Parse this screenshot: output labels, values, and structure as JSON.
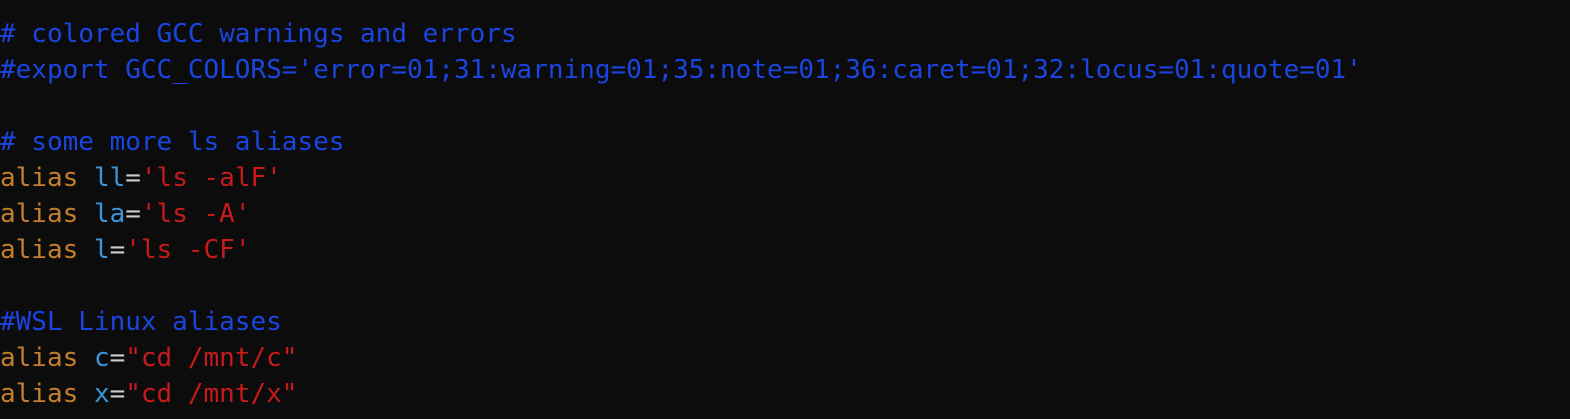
{
  "lines": [
    {
      "type": "comment",
      "text": "# colored GCC warnings and errors"
    },
    {
      "type": "comment",
      "text": "#export GCC_COLORS='error=01;31:warning=01;35:note=01;36:caret=01;32:locus=01:quote=01'"
    },
    {
      "type": "blank"
    },
    {
      "type": "comment",
      "text": "# some more ls aliases"
    },
    {
      "type": "alias",
      "keyword": "alias",
      "name": "ll",
      "eq": "=",
      "value": "'ls -alF'"
    },
    {
      "type": "alias",
      "keyword": "alias",
      "name": "la",
      "eq": "=",
      "value": "'ls -A'"
    },
    {
      "type": "alias",
      "keyword": "alias",
      "name": "l",
      "eq": "=",
      "value": "'ls -CF'"
    },
    {
      "type": "blank"
    },
    {
      "type": "comment",
      "text": "#WSL Linux aliases"
    },
    {
      "type": "alias",
      "keyword": "alias",
      "name": "c",
      "eq": "=",
      "value": "\"cd /mnt/c\""
    },
    {
      "type": "alias",
      "keyword": "alias",
      "name": "x",
      "eq": "=",
      "value": "\"cd /mnt/x\""
    }
  ],
  "colors": {
    "background": "#0c0c0c",
    "comment": "#1a45e0",
    "keyword": "#c47f2c",
    "alias_name": "#3b95d8",
    "operator": "#cccccc",
    "string": "#c71a1a"
  }
}
